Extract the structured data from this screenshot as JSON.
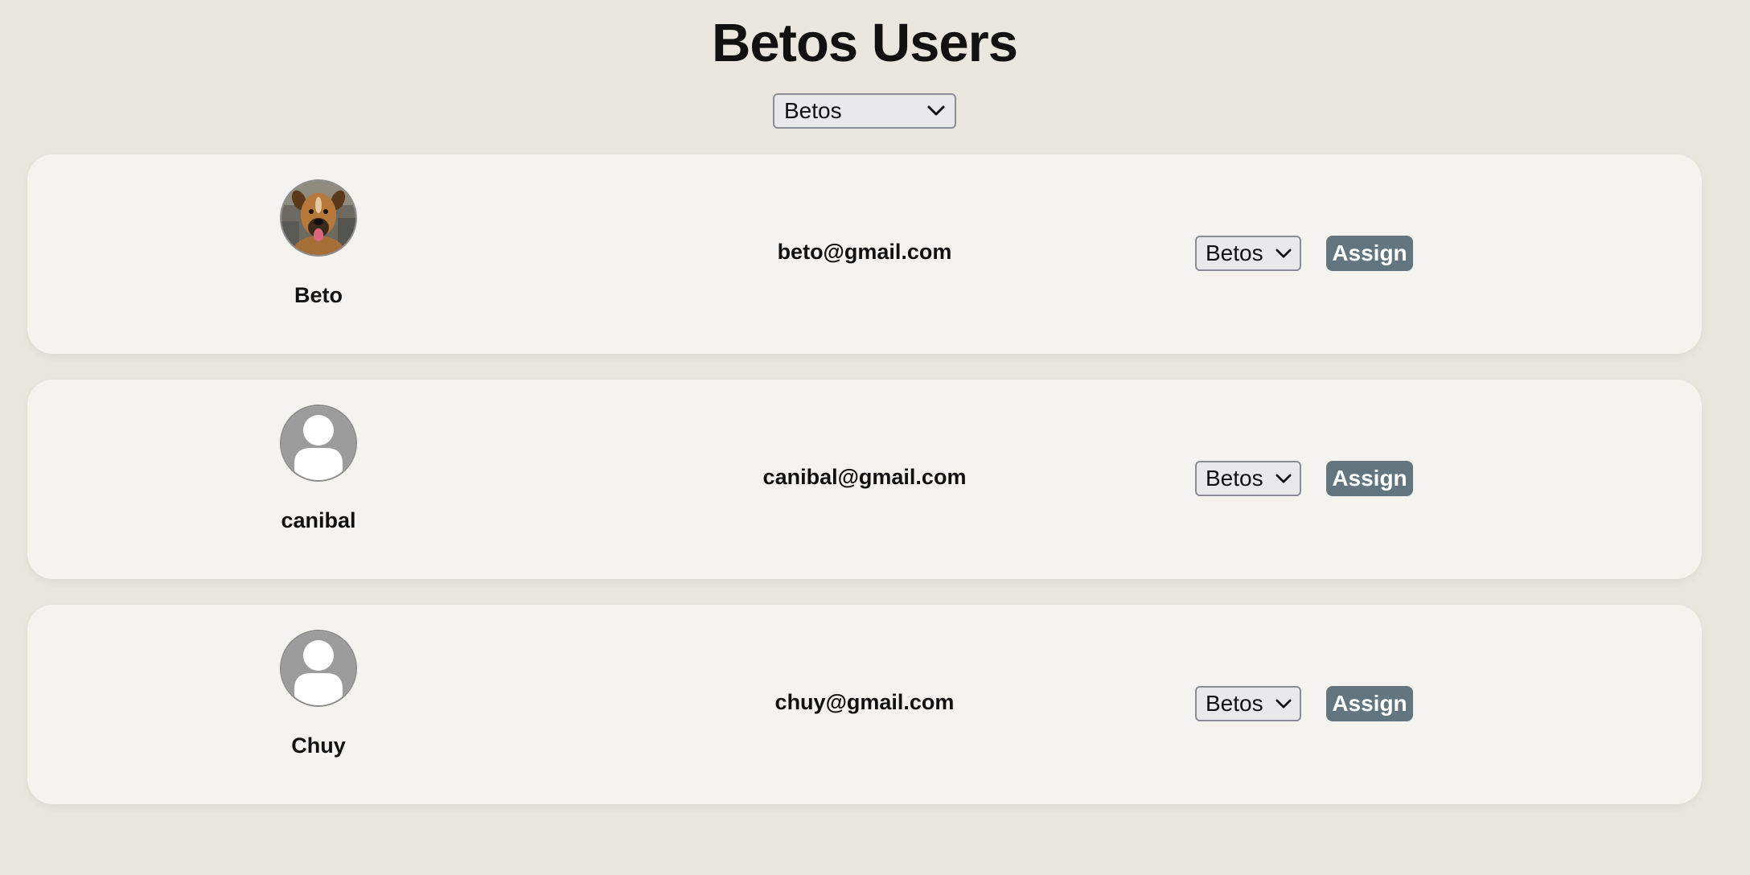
{
  "page": {
    "title": "Betos Users"
  },
  "filter": {
    "selected": "Betos"
  },
  "users": [
    {
      "name": "Beto",
      "email": "beto@gmail.com",
      "group": "Betos",
      "assign_label": "Assign",
      "avatar": "dog-photo"
    },
    {
      "name": "canibal",
      "email": "canibal@gmail.com",
      "group": "Betos",
      "assign_label": "Assign",
      "avatar": "default-user-icon"
    },
    {
      "name": "Chuy",
      "email": "chuy@gmail.com",
      "group": "Betos",
      "assign_label": "Assign",
      "avatar": "default-user-icon"
    }
  ],
  "colors": {
    "background": "#eae8de",
    "card": "#f4f3ef",
    "button": "#637680",
    "avatar_placeholder": "#9c9c9c"
  }
}
